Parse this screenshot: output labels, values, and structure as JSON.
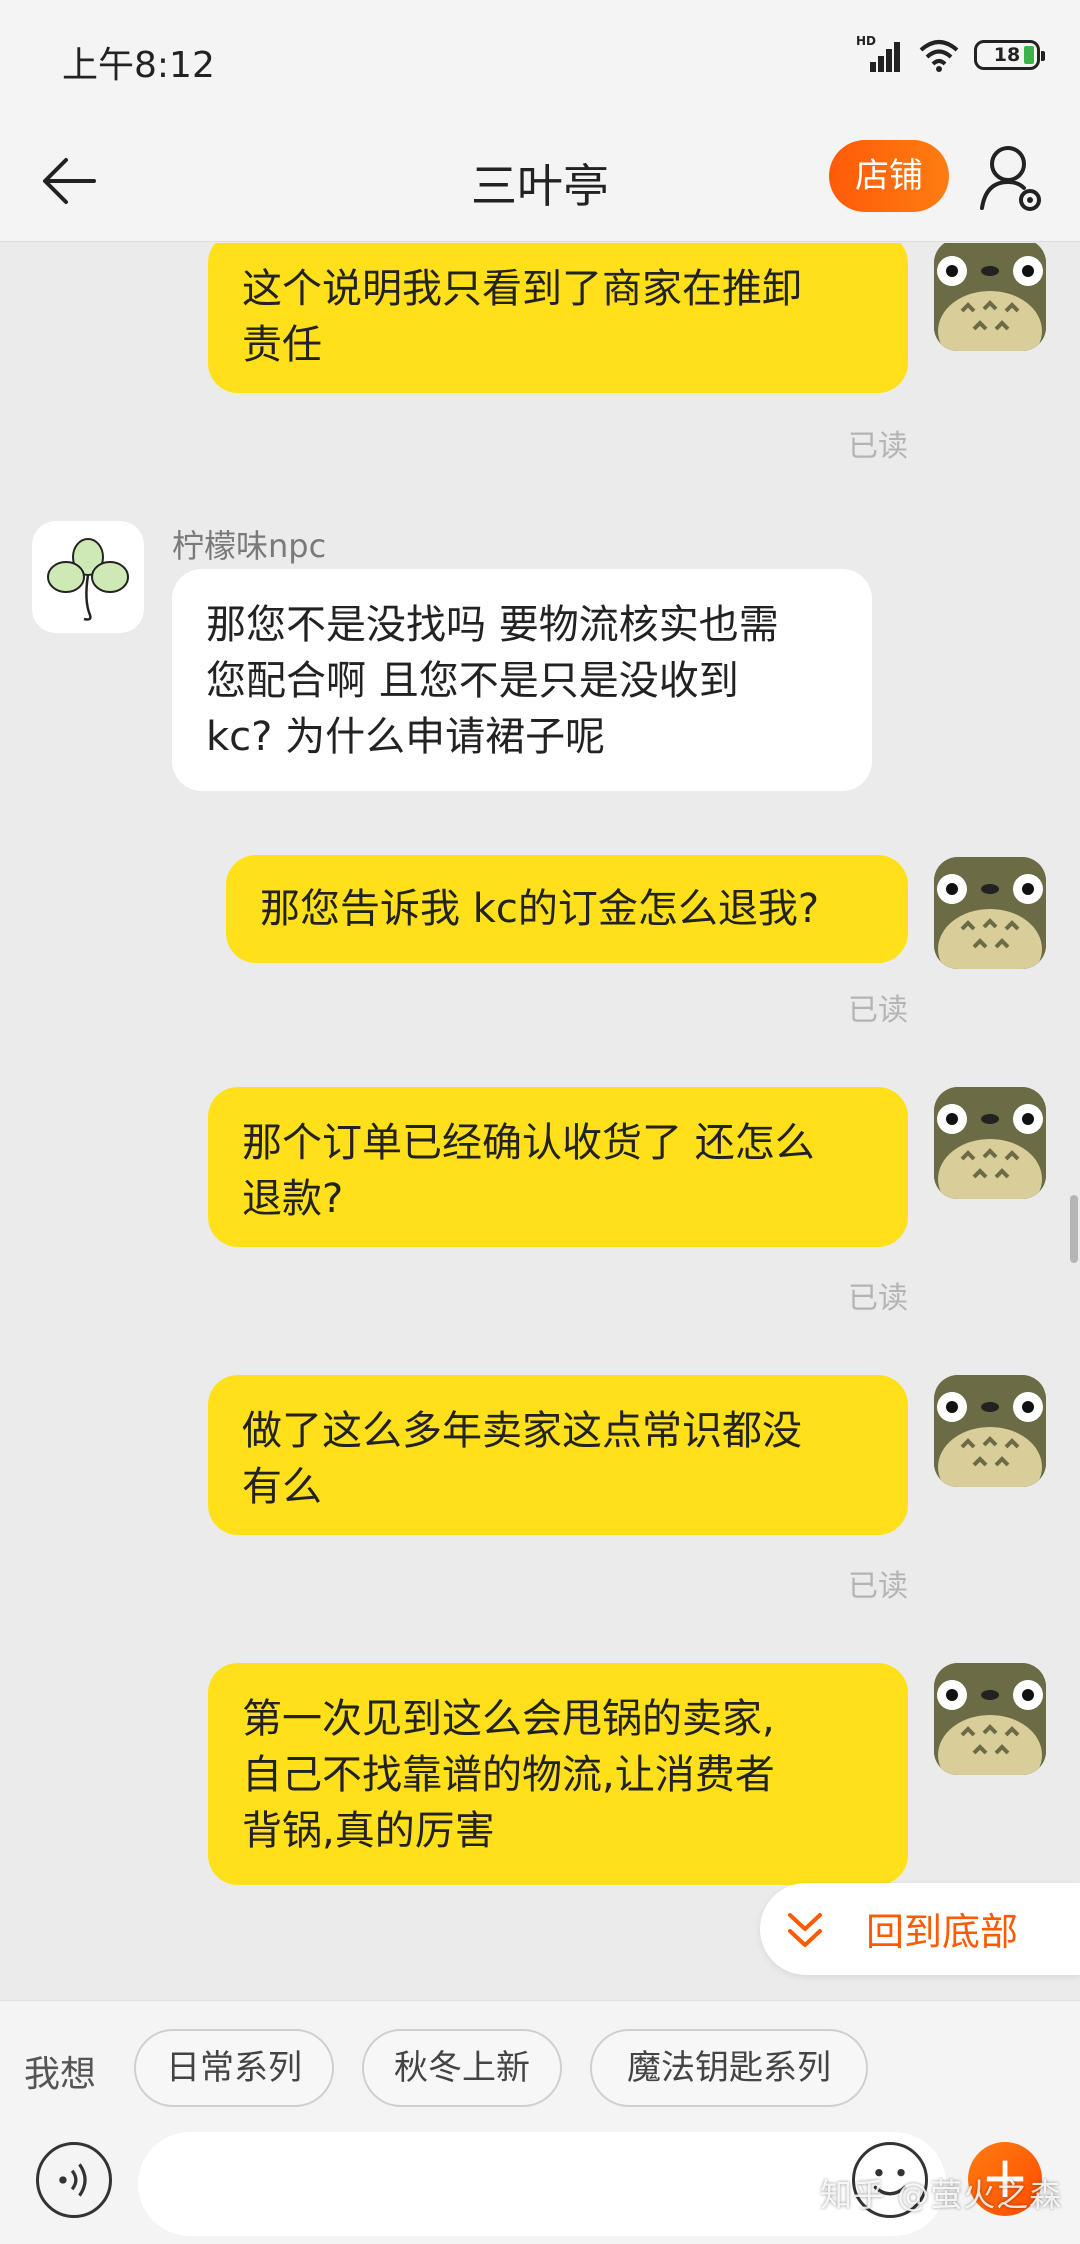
{
  "status_bar": {
    "time": "上午8:12",
    "network": "HD",
    "battery": "18"
  },
  "nav": {
    "title": "三叶亭",
    "shop_label": "店铺"
  },
  "messages": [
    {
      "sender": "me",
      "text_lines": [
        "这个说明我只看到了商家在推卸",
        "责任"
      ],
      "status": "已读"
    },
    {
      "sender": "them",
      "name": "柠檬味npc",
      "text_lines": [
        "那您不是没找吗 要物流核实也需",
        "您配合啊 且您不是只是没收到",
        "kc? 为什么申请裙子呢"
      ]
    },
    {
      "sender": "me",
      "text_lines": [
        "那您告诉我 kc的订金怎么退我?"
      ],
      "status": "已读"
    },
    {
      "sender": "me",
      "text_lines": [
        "那个订单已经确认收货了 还怎么",
        "退款?"
      ],
      "status": "已读"
    },
    {
      "sender": "me",
      "text_lines": [
        "做了这么多年卖家这点常识都没",
        "有么"
      ],
      "status": "已读"
    },
    {
      "sender": "me",
      "text_lines": [
        "第一次见到这么会甩锅的卖家,",
        "自己不找靠谱的物流,让消费者",
        "背锅,真的厉害"
      ]
    }
  ],
  "back_to_bottom": "回到底部",
  "quick_reply": {
    "label": "我想",
    "chips": [
      "日常系列",
      "秋冬上新",
      "魔法钥匙系列"
    ]
  },
  "input": {
    "placeholder": ""
  },
  "watermark": "知乎 @萤火之森",
  "colors": {
    "accent": "#ff5a00",
    "my_bubble": "#ffe01a",
    "their_bubble": "#ffffff"
  }
}
